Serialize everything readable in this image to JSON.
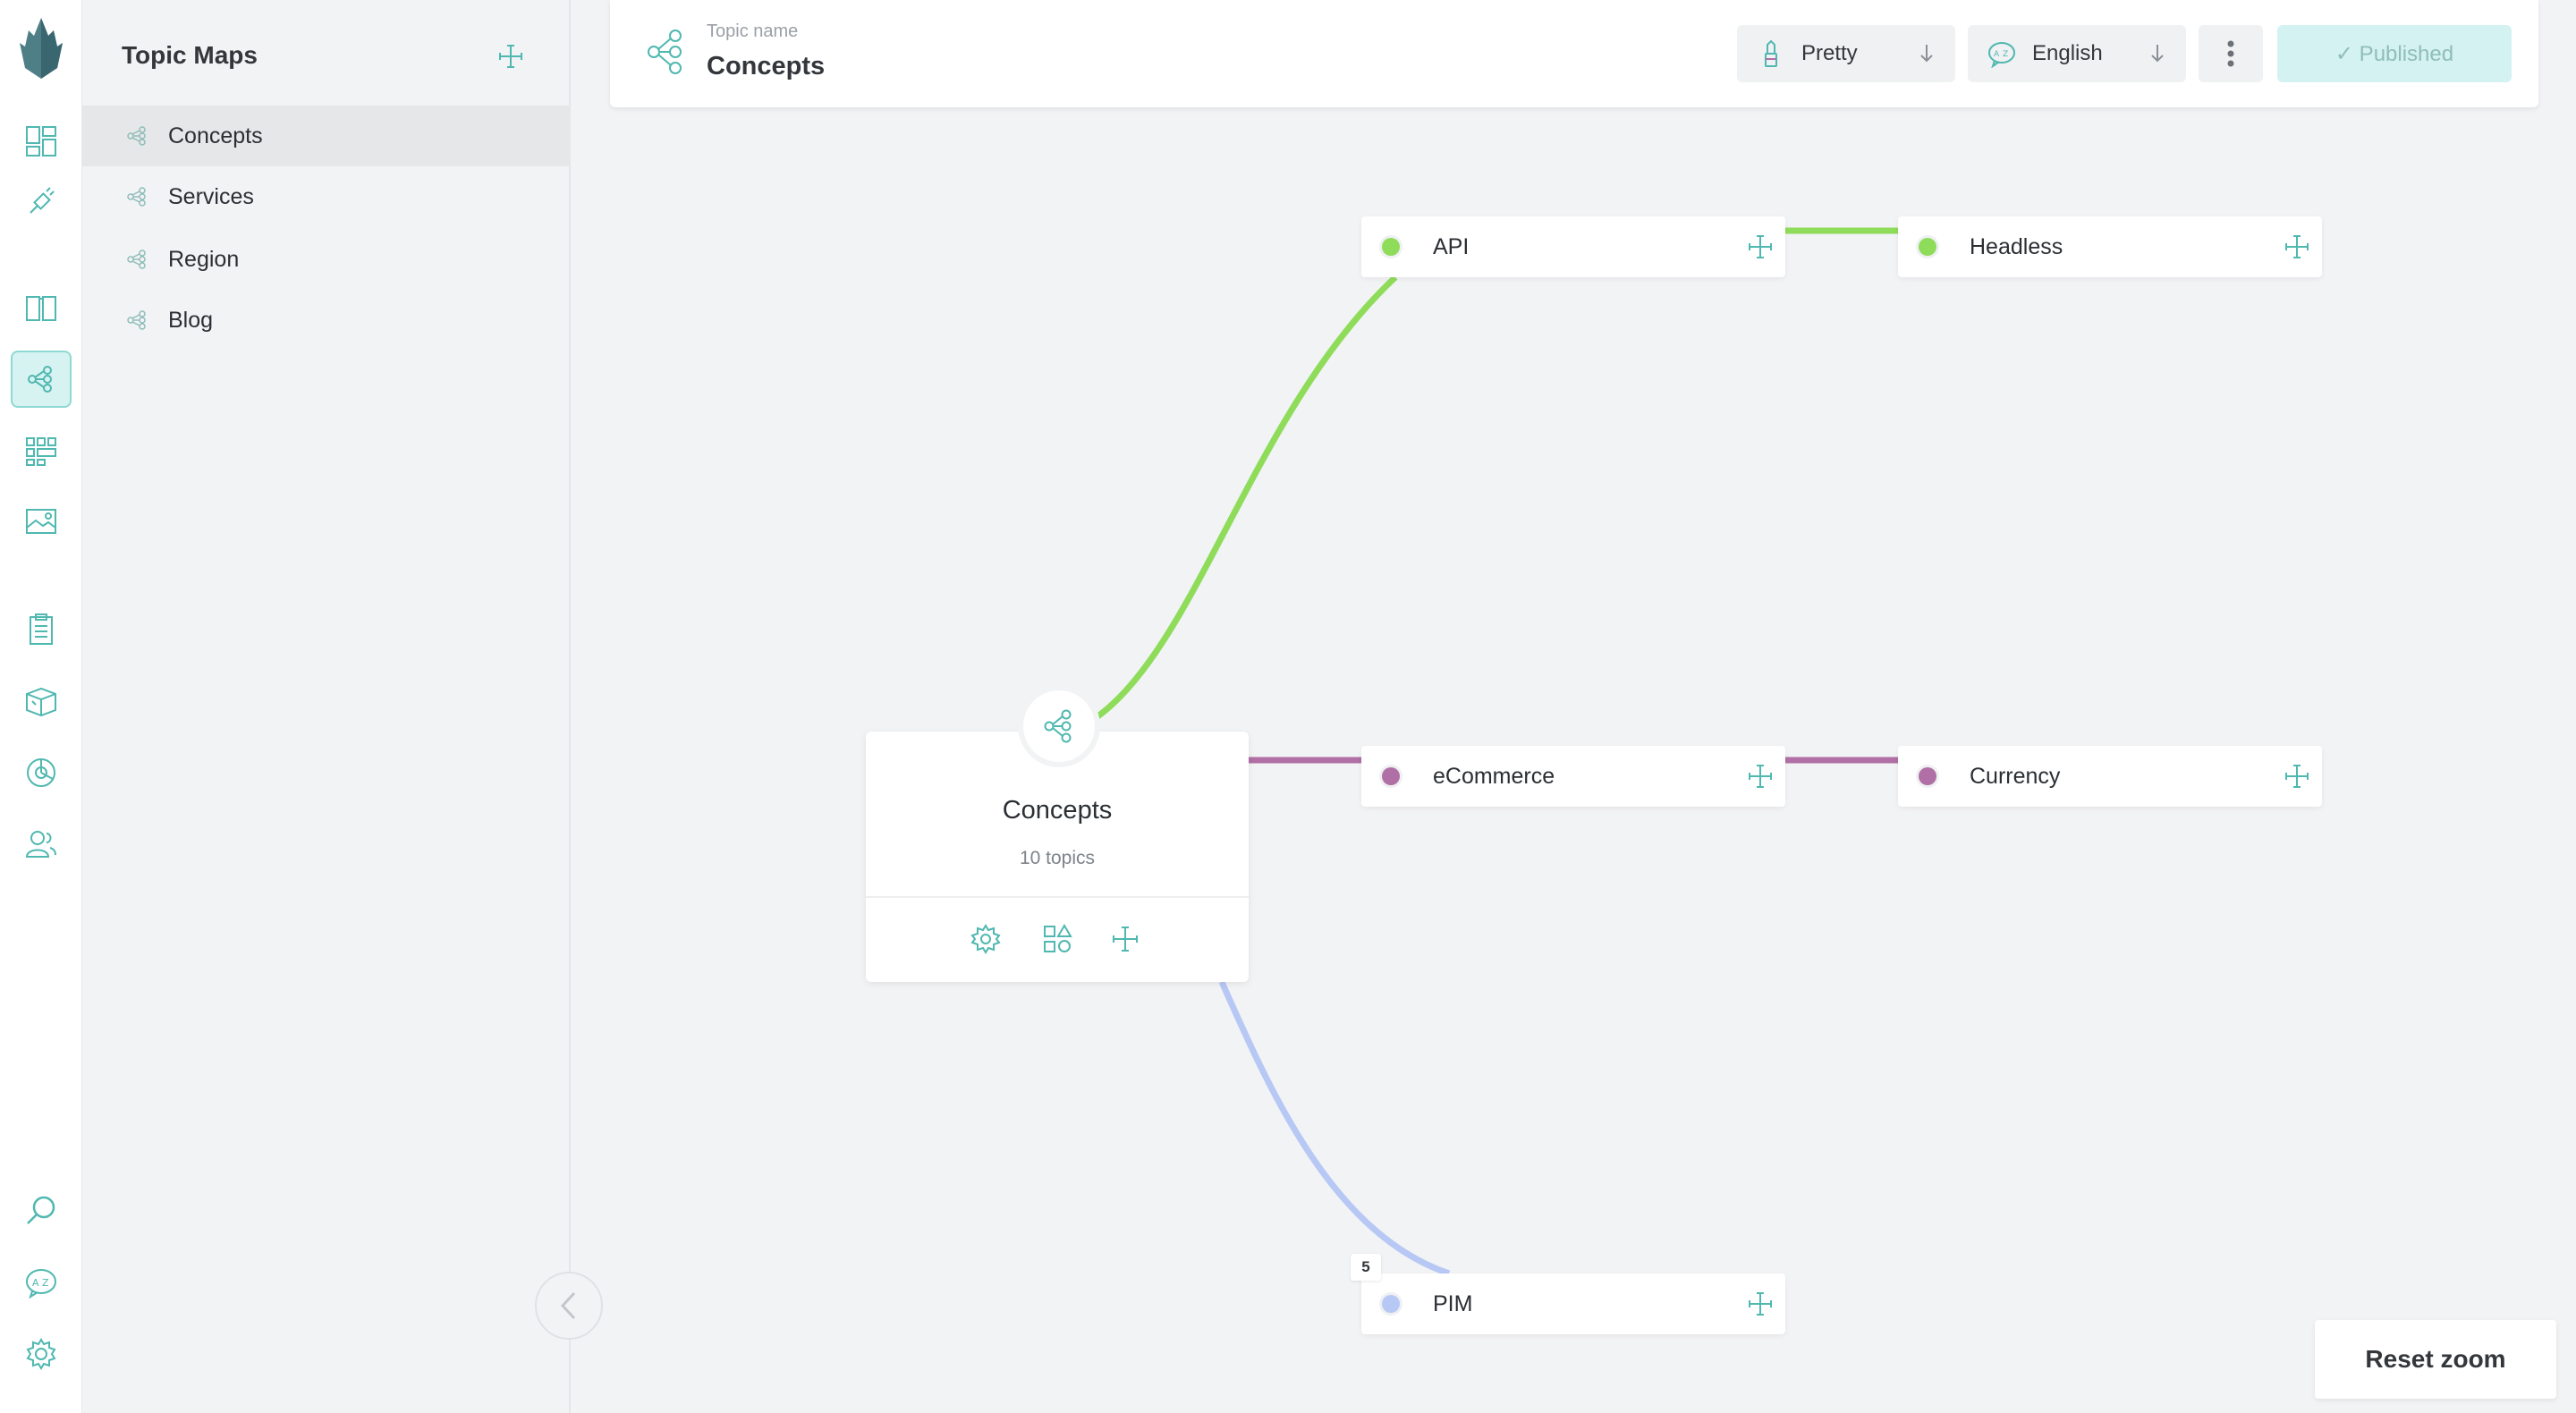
{
  "sidebar": {
    "title": "Topic Maps",
    "items": [
      {
        "label": "Concepts",
        "active": true
      },
      {
        "label": "Services",
        "active": false
      },
      {
        "label": "Region",
        "active": false
      },
      {
        "label": "Blog",
        "active": false
      }
    ]
  },
  "topbar": {
    "label": "Topic name",
    "name": "Concepts",
    "style_select": "Pretty",
    "language_select": "English",
    "status": "✓ Published"
  },
  "graph": {
    "root": {
      "title": "Concepts",
      "subtitle": "10 topics"
    },
    "nodes": [
      {
        "label": "API",
        "color": "#8fdc5a"
      },
      {
        "label": "Headless",
        "color": "#8fdc5a"
      },
      {
        "label": "eCommerce",
        "color": "#b06fa5"
      },
      {
        "label": "Currency",
        "color": "#b06fa5"
      },
      {
        "label": "PIM",
        "color": "#b7c8f5",
        "badge": "5"
      }
    ]
  },
  "reset_zoom": "Reset zoom",
  "colors": {
    "accent": "#4fb8b0",
    "accent_light": "#d7f3f1"
  }
}
